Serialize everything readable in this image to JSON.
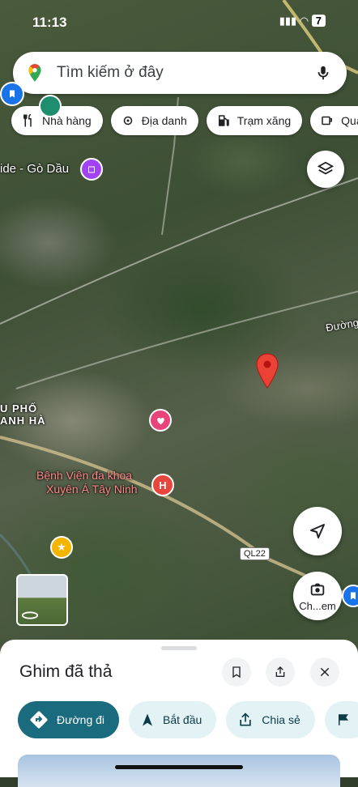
{
  "status_bar": {
    "time": "11:13",
    "battery": "7"
  },
  "search": {
    "placeholder": "Tìm kiếm ở đây"
  },
  "chips": [
    {
      "label": "Nhà hàng",
      "icon": "fork-knife-icon"
    },
    {
      "label": "Địa danh",
      "icon": "landmark-icon"
    },
    {
      "label": "Trạm xăng",
      "icon": "gas-station-icon"
    },
    {
      "label": "Quán",
      "icon": "coffee-icon"
    }
  ],
  "map_labels": {
    "place_go_dau": "ide - Gò Dầu",
    "road_duong": "Đường",
    "place_pho": "U PHỐ",
    "place_anh_ha": "ANH HÀ",
    "hospital_line1": "Bệnh Viện đa khoa",
    "hospital_line2": "Xuyên Á Tây Ninh",
    "highway": "QL22",
    "camera_label": "Ch...em"
  },
  "sheet": {
    "title": "Ghim đã thả",
    "actions": [
      {
        "label": "Đường đi",
        "icon": "directions-icon"
      },
      {
        "label": "Bắt đầu",
        "icon": "navigation-arrow-icon"
      },
      {
        "label": "Chia sẻ",
        "icon": "share-icon"
      }
    ]
  },
  "colors": {
    "primary": "#1a6b7e",
    "pin": "#ea4335",
    "chip_bg": "#ffffff"
  }
}
